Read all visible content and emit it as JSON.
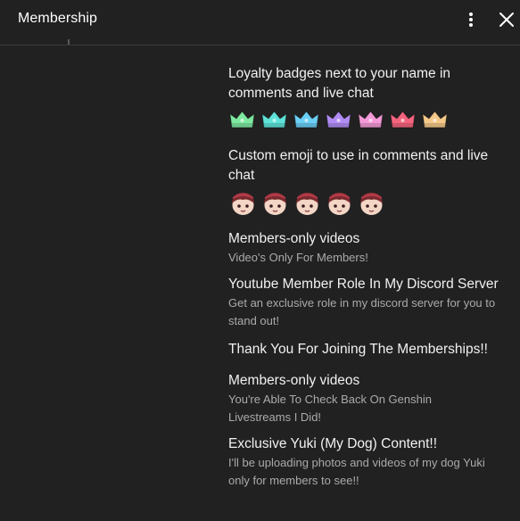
{
  "header": {
    "title": "Membership",
    "more_icon": "more-vert-icon",
    "close_icon": "close-icon"
  },
  "perks": {
    "badges": {
      "title": "Loyalty badges next to your name in comments and live chat",
      "colors": [
        "#7ee8a0",
        "#5fe3d9",
        "#6ccff6",
        "#b18cf5",
        "#f59ad8",
        "#f5647e",
        "#f5c98a"
      ]
    },
    "emoji": {
      "title": "Custom emoji to use in comments and live chat",
      "count": 5
    },
    "videos1": {
      "title": "Members-only videos",
      "desc": "Video's Only For Members!"
    },
    "discord": {
      "title": "Youtube Member Role In My Discord Server",
      "desc": "Get an exclusive role in my discord server for you to stand out!"
    },
    "thanks": {
      "title": "Thank You For Joining The Memberships!!"
    },
    "videos2": {
      "title": "Members-only videos",
      "desc": "You're Able To Check Back On Genshin Livestreams I Did!"
    },
    "yuki": {
      "title": "Exclusive Yuki (My Dog) Content!!",
      "desc": "I'll be uploading photos and videos of my dog Yuki only for members to see!!"
    }
  }
}
